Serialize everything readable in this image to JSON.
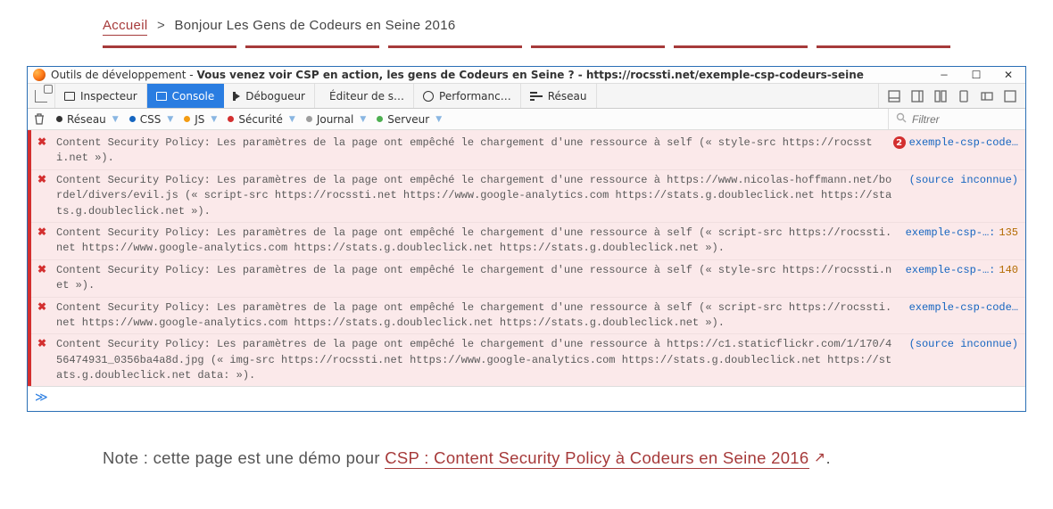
{
  "breadcrumb": {
    "home": "Accueil",
    "sep": ">",
    "current": "Bonjour Les Gens de Codeurs en Seine 2016"
  },
  "devtools": {
    "title_prefix": "Outils de développement - ",
    "title_bold": "Vous venez voir CSP en action, les gens de Codeurs en Seine ? - https://rocssti.net/exemple-csp-codeurs-seine",
    "tabs": {
      "inspector": "Inspecteur",
      "console": "Console",
      "debugger": "Débogueur",
      "style": "Éditeur de s…",
      "perf": "Performanc…",
      "network": "Réseau"
    },
    "filters": {
      "reseau": "Réseau",
      "css": "CSS",
      "js": "JS",
      "securite": "Sécurité",
      "journal": "Journal",
      "serveur": "Serveur"
    },
    "filter_placeholder": "Filtrer",
    "dots": {
      "reseau": "#333333",
      "css": "#1565c0",
      "js": "#f39c12",
      "securite": "#d32f2f",
      "journal": "#9e9e9e",
      "serveur": "#4caf50"
    },
    "logs": [
      {
        "msg": "Content Security Policy: Les paramètres de la page ont empêché le chargement d'une ressource à self (« style-src https://rocssti.net »).",
        "src": "exemple-csp-code…",
        "badge": "2"
      },
      {
        "msg": "Content Security Policy: Les paramètres de la page ont empêché le chargement d'une ressource à https://www.nicolas-hoffmann.net/bordel/divers/evil.js (« script-src https://rocssti.net https://www.google-analytics.com https://stats.g.doubleclick.net https://stats.g.doubleclick.net »).",
        "src": "(source inconnue)"
      },
      {
        "msg": "Content Security Policy: Les paramètres de la page ont empêché le chargement d'une ressource à self (« script-src https://rocssti.net https://www.google-analytics.com https://stats.g.doubleclick.net https://stats.g.doubleclick.net »).",
        "src": "exemple-csp-…:",
        "line": "135"
      },
      {
        "msg": "Content Security Policy: Les paramètres de la page ont empêché le chargement d'une ressource à self (« style-src https://rocssti.net »).",
        "src": "exemple-csp-…:",
        "line": "140"
      },
      {
        "msg": "Content Security Policy: Les paramètres de la page ont empêché le chargement d'une ressource à self (« script-src https://rocssti.net https://www.google-analytics.com https://stats.g.doubleclick.net https://stats.g.doubleclick.net »).",
        "src": "exemple-csp-code…"
      },
      {
        "msg": "Content Security Policy: Les paramètres de la page ont empêché le chargement d'une ressource à https://c1.staticflickr.com/1/170/456474931_0356ba4a8d.jpg (« img-src https://rocssti.net https://www.google-analytics.com https://stats.g.doubleclick.net https://stats.g.doubleclick.net data: »).",
        "src": "(source inconnue)"
      }
    ],
    "prompt": "≫"
  },
  "note": {
    "prefix": "Note : cette page est une démo pour ",
    "link": "CSP : Content Security Policy à Codeurs en Seine 2016",
    "ext": "↗",
    "suffix": "."
  }
}
